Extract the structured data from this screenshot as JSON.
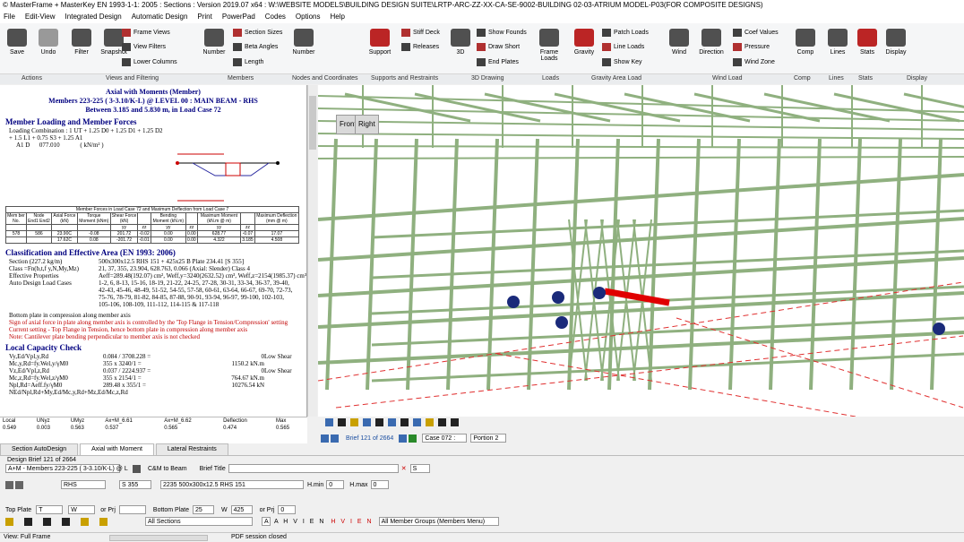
{
  "window": {
    "title": "© MasterFrame + MasterKey EN 1993-1-1: 2005 : Sections : Version 2019.07 x64 : W:\\WEBSITE MODELS\\BUILDING DESIGN SUITE\\LRTP-ARC-ZZ-XX-CA-SE-9002-BUILDING 02-03-ATRIUM MODEL-P03(FOR COMPOSITE DESIGNS)"
  },
  "menu": [
    "File",
    "Edit-View",
    "Integrated Design",
    "Automatic Design",
    "Print",
    "PowerPad",
    "Codes",
    "Options",
    "Help"
  ],
  "ribbon": {
    "large": [
      {
        "label": "Save",
        "icon": "save-icon",
        "color": "#333333"
      },
      {
        "label": "Undo",
        "icon": "undo-icon",
        "color": "#888888"
      },
      {
        "label": "Filter",
        "icon": "filter-icon",
        "color": "#333333"
      },
      {
        "label": "Snapshot",
        "icon": "camera-icon",
        "color": "#333333"
      },
      {
        "label": "Number",
        "icon": "member-number-icon",
        "color": "#333333"
      },
      {
        "label": "Number",
        "icon": "node-number-icon",
        "color": "#333333"
      },
      {
        "label": "Support",
        "icon": "support-icon",
        "color": "#b00000"
      },
      {
        "label": "3D",
        "icon": "cube-icon",
        "color": "#333333"
      },
      {
        "label": "Frame Loads",
        "icon": "frame-loads-icon",
        "color": "#333333"
      },
      {
        "label": "Gravity",
        "icon": "gravity-icon",
        "color": "#b00000"
      },
      {
        "label": "Wind",
        "icon": "wind-icon",
        "color": "#333333"
      },
      {
        "label": "Direction",
        "icon": "direction-icon",
        "color": "#333333"
      },
      {
        "label": "Comp",
        "icon": "comp-icon",
        "color": "#333333"
      },
      {
        "label": "Lines",
        "icon": "lines-icon",
        "color": "#333333"
      },
      {
        "label": "Stats",
        "icon": "stats-icon",
        "color": "#b00000"
      },
      {
        "label": "Display",
        "icon": "gear-icon",
        "color": "#333333"
      }
    ],
    "small": [
      {
        "label": "Frame Views"
      },
      {
        "label": "View Filters"
      },
      {
        "label": "Lower Columns"
      },
      {
        "label": "Section Sizes"
      },
      {
        "label": "Beta Angles"
      },
      {
        "label": "Length"
      },
      {
        "label": "Stiff Deck"
      },
      {
        "label": "Releases"
      },
      {
        "label": "Show Founds"
      },
      {
        "label": "Draw Short"
      },
      {
        "label": "End Plates"
      },
      {
        "label": "Patch Loads"
      },
      {
        "label": "Line Loads"
      },
      {
        "label": "Show Key"
      },
      {
        "label": "Coef Values"
      },
      {
        "label": "Pressure"
      },
      {
        "label": "Wind Zone"
      }
    ],
    "groups": [
      "Actions",
      "Views and Filtering",
      "Members",
      "Nodes and Coordinates",
      "Supports and Restraints",
      "3D Drawing",
      "Loads",
      "Gravity Area Load",
      "Wind Load",
      "Comp",
      "Lines",
      "Stats",
      "Display"
    ]
  },
  "report": {
    "heading": "Axial with Moments (Member)",
    "subheading": "Members 223-225 ( 3-3.10/K-L) @ LEVEL 00 : MAIN BEAM - RHS",
    "subheading2": "Between 3.185 and 5.830 m, in Load Case  72",
    "s1": "Member Loading and Member Forces",
    "loading": "Loading Combination : 1 UT + 1.25 D0 + 1.25 D1 + 1.25 D2",
    "loading2": "+ 1.5 L1 + 0.75 S3 + 1.25 A1",
    "loadrow": "A1 D      077.010             ( kN/m² )",
    "table_title": "Member Forces in Load Case 72 and Maximum Deflection from Load Case 7",
    "table_head": [
      "Mem ber No.",
      "Node End1 End2",
      "Axial Force (kN)",
      "Torque Moment (kNm)",
      "Shear Force (kN)",
      "",
      "Bending Moment (kN.m)",
      "",
      "Maximum Moment (kN.m @ m)",
      "",
      "Maximum Deflection (mm @ m)"
    ],
    "table_sub": [
      "yy",
      "zz",
      "yy",
      "zz",
      "yy",
      "zz"
    ],
    "rows": [
      [
        "578",
        "586",
        "23.90C",
        "-0.08",
        "201.72",
        "-0.02",
        "0.00",
        "0.00",
        "628.77",
        "-0.07",
        "17.07"
      ],
      [
        "",
        "",
        "17.62C",
        "0.08",
        "-201.72",
        "-0.01",
        "0.00",
        "0.00",
        "4.322",
        "3.185",
        "4.508"
      ]
    ],
    "s2": "Classification and Effective Area (EN 1993: 2006)",
    "class_lines": [
      [
        "Section (227.2 kg/m)",
        "500x300x12.5 RHS 151 + 425x25 B Plate 234.41 [S 355]"
      ],
      [
        "Class =Fn(b,t,f y,N,My,Mz)",
        "21, 37, 355, 23.904, 628.763, 0.066         (Axial: Slender)      Class 4"
      ],
      [
        "Effective Properties",
        "Aeff=289.48(192.07) cm², Weff,y=3240(2632.52) cm³, Weff,z=2154(1985.37) cm³"
      ],
      [
        "Auto Design Load Cases",
        "1-2, 6, 8-13, 15-16, 18-19, 21-22, 24-25, 27-28, 30-31, 33-34, 36-37, 39-40,"
      ],
      [
        "",
        "42-43, 45-46, 48-49, 51-52, 54-55, 57-58, 60-61, 63-64, 66-67, 69-70, 72-73,"
      ],
      [
        "",
        "75-76, 78-79, 81-82, 84-85, 87-88, 90-91, 93-94, 96-97, 99-100, 102-103,"
      ],
      [
        "",
        "105-106, 108-109, 111-112, 114-115 & 117-118"
      ]
    ],
    "plate_note": "Bottom plate in compression along member axis",
    "red_notes": [
      "Sign of axial force in plate along member axis is controlled by the 'Top Flange in Tension/Compression' setting",
      "Current setting - Top Flange in Tension, hence bottom plate in compression along member axis",
      "Note: Cantilever plate bending perpendicular to member axis is not checked"
    ],
    "s3": "Local Capacity Check",
    "cap_lines": [
      [
        "Vy,Ed/Vpl,y,Rd",
        "0.084 / 3708.228 =",
        "0",
        "Low Shear"
      ],
      [
        "Mc,y,Rd=fy.Wel,y/γM0",
        "355 x 3240/1 =",
        "1150.2 kN.m",
        ""
      ],
      [
        "Vz,Ed/Vpl,z,Rd",
        "0.037 / 2224.937 =",
        "0",
        "Low Shear"
      ],
      [
        "Mc,z,Rd=fy.Wel,z/γM0",
        "355 x 2154/1 =",
        "764.67 kN.m",
        ""
      ],
      [
        "Npl,Rd=Aeff.fy/γM0",
        "289.48 x 355/1 =",
        "10276.54 kN",
        ""
      ],
      [
        "NEd/Npl,Rd+My,Ed/Mc,y,Rd+Mz,Ed/Mc,z,Rd",
        "",
        "",
        ""
      ]
    ]
  },
  "summary": {
    "heads": [
      "Local",
      "UNyz",
      "UMyz",
      "Ax+M_6.61",
      "Ax+M_6.62",
      "Deflection",
      "Max"
    ],
    "vals": [
      "0.549",
      "0.003",
      "0.563",
      "0.537",
      "0.565",
      "0.474",
      "0.565"
    ]
  },
  "view": {
    "front": "Front",
    "right": "Right",
    "brief": "Brief 121 of 2664",
    "case": "Case 072 :",
    "portion": "Portion 2",
    "bg": "#ffffff",
    "steel": "#8fb07f",
    "highlight": "#e00000"
  },
  "tabs": [
    "Section AutoDesign",
    "Axial with Moment",
    "Lateral Restraints"
  ],
  "panel": {
    "brief_label": "Design Brief 121 of 2664",
    "member_combo": "A+M - Members 223-225 ( 3-3.10/K-L) @ L",
    "c2b": "C&M to Beam",
    "brief_title": "Brief Title",
    "shape": "RHS",
    "grade": "S 355",
    "section": "2235 500x300x12.5 RHS 151",
    "hmin_label": "H.min",
    "hmin": "0",
    "hmax_label": "H.max",
    "hmax": "0",
    "top_plate": "Top Plate",
    "t_label": "T",
    "w_label": "W",
    "or_prj": "or Prj",
    "bottom_plate": "Bottom Plate",
    "bt": "25",
    "bw": "425",
    "bprj": "0",
    "sections": "All Sections",
    "letters": "A H V I E N",
    "red_letters": "H V I E N",
    "groups": "All Member Groups (Members Menu)"
  },
  "status": {
    "view": "View: Full Frame",
    "pdf": "PDF session closed"
  }
}
